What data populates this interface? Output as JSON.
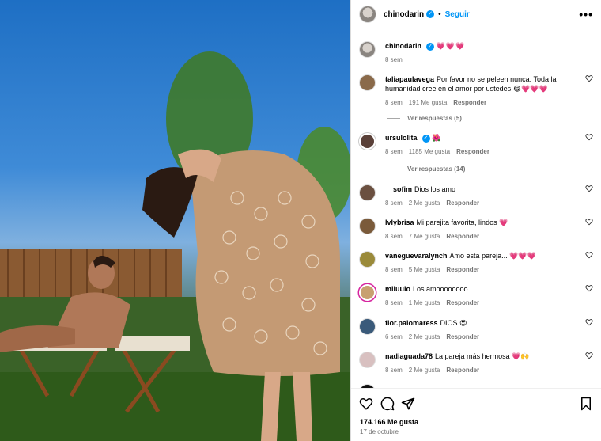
{
  "post": {
    "username": "chinodarin",
    "follow_label": "Seguir",
    "more_label": "•••",
    "caption_emojis": "💗💗💗",
    "caption_time": "8 sem",
    "likes": "174.166 Me gusta",
    "date": "17 de octubre"
  },
  "comments": [
    {
      "user": "taliapaulavega",
      "text": "Por favor no se peleen nunca. Toda la humanidad cree en el amor por ustedes 😂💗💗💗",
      "time": "8 sem",
      "likes": "191 Me gusta",
      "reply": "Responder",
      "replies": "Ver respuestas (5)",
      "avatar_color": "#8a6a4a"
    },
    {
      "user": "ursulolita",
      "text": "🌺",
      "time": "8 sem",
      "likes": "1185 Me gusta",
      "reply": "Responder",
      "replies": "Ver respuestas (14)",
      "avatar_color": "#5a4038"
    },
    {
      "user": "__sofim",
      "text": "Dios los amo",
      "time": "8 sem",
      "likes": "2 Me gusta",
      "reply": "Responder",
      "avatar_color": "#6b5040"
    },
    {
      "user": "lvlybrisa",
      "text": "Mi parejita favorita, lindos 💗",
      "time": "8 sem",
      "likes": "7 Me gusta",
      "reply": "Responder",
      "avatar_color": "#7a5a3a"
    },
    {
      "user": "vaneguevaralynch",
      "text": "Amo esta pareja... 💗💗💗",
      "time": "8 sem",
      "likes": "5 Me gusta",
      "reply": "Responder",
      "avatar_color": "#9a8a3a"
    },
    {
      "user": "miluulo",
      "text": "Los amoooooooo",
      "time": "8 sem",
      "likes": "1 Me gusta",
      "reply": "Responder",
      "avatar_color": "#c8a070"
    },
    {
      "user": "flor.palomaress",
      "text": "DIOS 😍",
      "time": "6 sem",
      "likes": "2 Me gusta",
      "reply": "Responder",
      "avatar_color": "#3a5a7a"
    },
    {
      "user": "nadiaguada78",
      "text": "La pareja más hermosa 💗🙌",
      "time": "8 sem",
      "likes": "2 Me gusta",
      "reply": "Responder",
      "avatar_color": "#d8c0c0"
    }
  ],
  "icons": {
    "like": "heart-icon",
    "comment": "comment-icon",
    "share": "share-icon",
    "save": "bookmark-icon"
  },
  "colors": {
    "accent": "#0095f6",
    "heart": "#ff3040"
  }
}
